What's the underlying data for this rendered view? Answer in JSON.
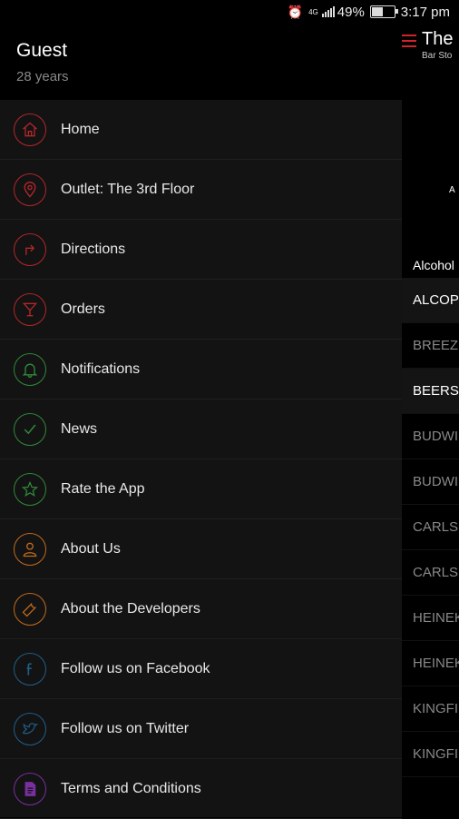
{
  "status_bar": {
    "battery": "49%",
    "time": "3:17 pm",
    "network": "4G"
  },
  "background_app": {
    "title": "The",
    "subtitle": "Bar Sto",
    "logo_text": "A",
    "category_title": "Alcohol",
    "rows": [
      {
        "label": "ALCOP",
        "category": true
      },
      {
        "label": "BREEZ",
        "category": false
      },
      {
        "label": "BEERS",
        "category": true
      },
      {
        "label": "BUDWI",
        "category": false
      },
      {
        "label": "BUDWI",
        "category": false
      },
      {
        "label": "CARLS",
        "category": false
      },
      {
        "label": "CARLS",
        "category": false
      },
      {
        "label": "HEINEK",
        "category": false
      },
      {
        "label": "HEINEK",
        "category": false
      },
      {
        "label": "KINGFI",
        "category": false
      },
      {
        "label": "KINGFI",
        "category": false
      }
    ]
  },
  "drawer": {
    "user_name": "Guest",
    "user_age": "28 years",
    "items": [
      {
        "label": "Home",
        "icon": "home-icon",
        "color": "#b3262a"
      },
      {
        "label": "Outlet: The 3rd Floor",
        "icon": "location-pin-icon",
        "color": "#b3262a"
      },
      {
        "label": "Directions",
        "icon": "directions-icon",
        "color": "#b3262a"
      },
      {
        "label": "Orders",
        "icon": "cocktail-glass-icon",
        "color": "#b3262a"
      },
      {
        "label": "Notifications",
        "icon": "bell-icon",
        "color": "#2f8a3a"
      },
      {
        "label": "News",
        "icon": "checkmark-icon",
        "color": "#2f8a3a"
      },
      {
        "label": "Rate the App",
        "icon": "star-icon",
        "color": "#2f8a3a"
      },
      {
        "label": "About Us",
        "icon": "person-icon",
        "color": "#c26a1c"
      },
      {
        "label": "About the Developers",
        "icon": "wrench-icon",
        "color": "#c26a1c"
      },
      {
        "label": "Follow us on Facebook",
        "icon": "facebook-icon",
        "color": "#1f5f8a"
      },
      {
        "label": "Follow us on Twitter",
        "icon": "twitter-icon",
        "color": "#1f5f8a"
      },
      {
        "label": "Terms and Conditions",
        "icon": "document-icon",
        "color": "#7a2f9e"
      }
    ]
  }
}
